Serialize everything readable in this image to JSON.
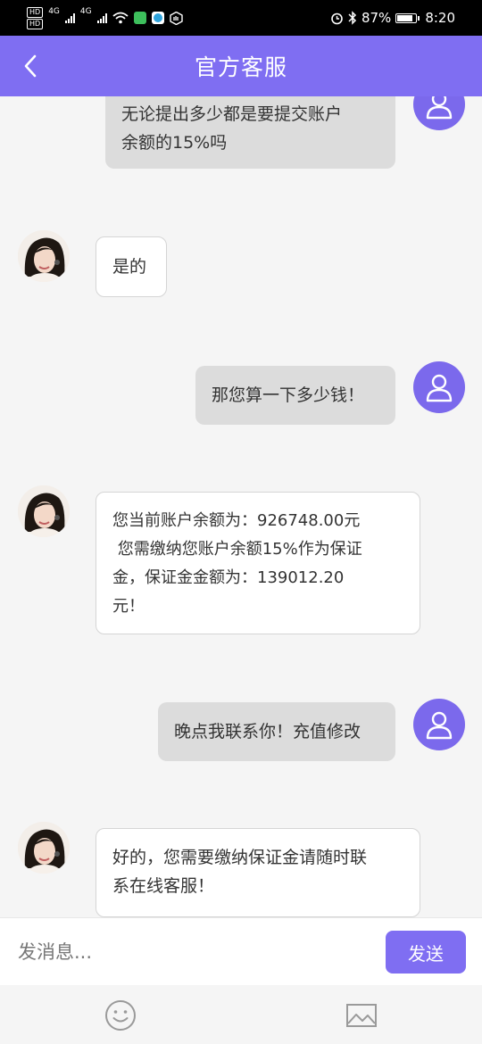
{
  "status_bar": {
    "network_badges": [
      "HD",
      "HD"
    ],
    "network_labels": [
      "4G",
      "4G"
    ],
    "battery_percent": "87%",
    "battery_level": 0.87,
    "time": "8:20"
  },
  "header": {
    "title": "官方客服",
    "back_icon": "chevron-left-icon"
  },
  "colors": {
    "accent": "#7f6ef2",
    "user_avatar": "#7b69ec",
    "user_bubble": "#dcdcdc",
    "agent_bubble": "#ffffff",
    "background": "#f5f5f5"
  },
  "messages": [
    {
      "sender": "user",
      "lines": [
        "无论提出多少都是要提交账户",
        "余额的15%吗"
      ]
    },
    {
      "sender": "agent",
      "lines": [
        "是的"
      ]
    },
    {
      "sender": "user",
      "lines": [
        "那您算一下多少钱！"
      ]
    },
    {
      "sender": "agent",
      "lines": [
        "您当前账户余额为：926748.00元",
        " 您需缴纳您账户余额15%作为保证",
        "金，保证金金额为：139012.20",
        "元！"
      ]
    },
    {
      "sender": "user",
      "lines": [
        "晚点我联系你！充值修改"
      ]
    },
    {
      "sender": "agent",
      "lines": [
        "好的，您需要缴纳保证金请随时联",
        "系在线客服！"
      ]
    }
  ],
  "composer": {
    "placeholder": "发消息...",
    "send_label": "发送"
  },
  "toolbar": {
    "emoji_icon": "smiley-icon",
    "image_icon": "image-icon"
  }
}
